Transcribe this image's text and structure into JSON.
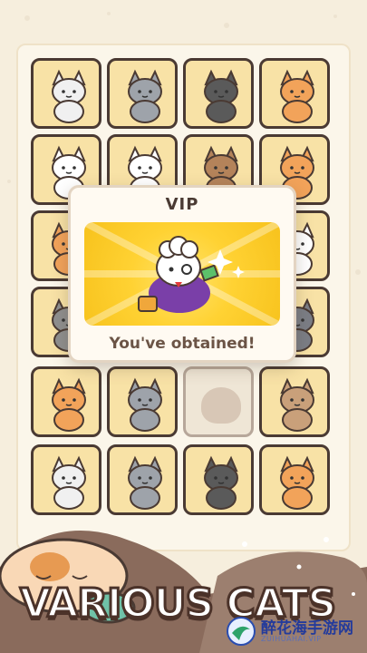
{
  "popup": {
    "title": "VIP",
    "message": "You've obtained!"
  },
  "banner": {
    "text": "VARIOUS CATS"
  },
  "watermark": {
    "name": "醉花海手游网",
    "url": "ZUIHUAHAI.VIP"
  },
  "colors": {
    "tile_bg": "#f8e2a6",
    "tile_border": "#4a3a33",
    "card_yellow": "#ffd233",
    "brown": "#4a3a33"
  },
  "grid": {
    "cats": [
      {
        "name": "red-hood-cat",
        "locked": false
      },
      {
        "name": "raccoon-cat",
        "locked": false
      },
      {
        "name": "batman-cat",
        "locked": false
      },
      {
        "name": "orange-tabby-cat",
        "locked": false
      },
      {
        "name": "king-cat",
        "locked": false
      },
      {
        "name": "fluffy-white-cat",
        "locked": false
      },
      {
        "name": "farmer-cat",
        "locked": false
      },
      {
        "name": "superhero-cat",
        "locked": false
      },
      {
        "name": "orange-cat",
        "locked": false
      },
      {
        "name": "panda-cat",
        "locked": false
      },
      {
        "name": "locked-cat",
        "locked": true
      },
      {
        "name": "white-cat",
        "locked": false
      },
      {
        "name": "calico-cat",
        "locked": false
      },
      {
        "name": "hawaiian-cat",
        "locked": false
      },
      {
        "name": "pirate-cat",
        "locked": false
      },
      {
        "name": "gray-white-cat",
        "locked": false
      },
      {
        "name": "orange-stripe-cat",
        "locked": false
      },
      {
        "name": "gray-tabby-cat",
        "locked": false
      },
      {
        "name": "locked-cat-2",
        "locked": true
      },
      {
        "name": "brown-cat",
        "locked": false
      }
    ]
  }
}
